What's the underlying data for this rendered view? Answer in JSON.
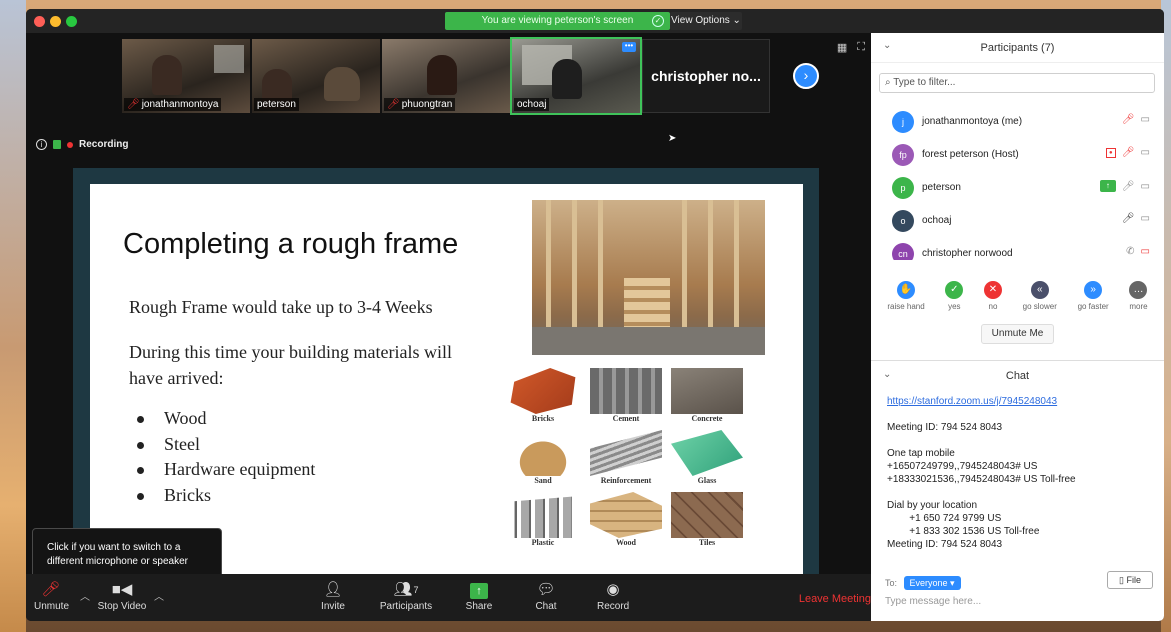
{
  "window": {
    "share_banner": "You are viewing peterson's screen",
    "view_options": "View Options ⌄"
  },
  "thumbnails": [
    {
      "label": "jonathanmontoya",
      "muted": true
    },
    {
      "label": "peterson",
      "muted": false
    },
    {
      "label": "phuongtran",
      "muted": true
    },
    {
      "label": "ochoaj",
      "muted": false,
      "active": true
    },
    {
      "label": "christopher no..."
    }
  ],
  "recording": {
    "label": "Recording"
  },
  "slide": {
    "title": "Completing a rough frame",
    "line1": "Rough Frame would take up to 3-4 Weeks",
    "line2": "During this time your building materials will have arrived:",
    "bullets": [
      "Wood",
      "Steel",
      "Hardware equipment",
      "Bricks"
    ],
    "materials": [
      "Bricks",
      "Cement",
      "Concrete",
      "Sand",
      "Reinforcement",
      "Glass",
      "Plastic",
      "Wood",
      "Tiles"
    ]
  },
  "tooltip": {
    "text": "Click if you want to switch to a different microphone or speaker"
  },
  "toolbar": {
    "unmute": "Unmute",
    "stop_video": "Stop Video",
    "invite": "Invite",
    "participants": "Participants",
    "participants_count": "7",
    "share": "Share",
    "chat": "Chat",
    "record": "Record",
    "leave": "Leave Meeting"
  },
  "participants_panel": {
    "title": "Participants (7)",
    "filter_placeholder": "Type to filter...",
    "list": [
      {
        "initials": "j",
        "name": "jonathanmontoya (me)",
        "color": "#2d8cff"
      },
      {
        "initials": "fp",
        "name": "forest peterson (Host)",
        "color": "#9b59b6"
      },
      {
        "initials": "p",
        "name": "peterson",
        "color": "#3cb54a"
      },
      {
        "initials": "o",
        "name": "ochoaj",
        "color": "#34495e"
      },
      {
        "initials": "cn",
        "name": "christopher norwood",
        "color": "#8e44ad"
      }
    ],
    "reactions": [
      {
        "label": "raise hand",
        "color": "#2d8cff",
        "glyph": "✋"
      },
      {
        "label": "yes",
        "color": "#3cb54a",
        "glyph": "✓"
      },
      {
        "label": "no",
        "color": "#e33",
        "glyph": "✕"
      },
      {
        "label": "go slower",
        "color": "#4a4f6a",
        "glyph": "«"
      },
      {
        "label": "go faster",
        "color": "#2d8cff",
        "glyph": "»"
      },
      {
        "label": "more",
        "color": "#666",
        "glyph": "…"
      }
    ],
    "unmute_me": "Unmute Me"
  },
  "chat": {
    "title": "Chat",
    "link": "https://stanford.zoom.us/j/7945248043",
    "meeting_id": "Meeting ID: 794 524 8043",
    "one_tap": "One tap mobile\n+16507249799,,7945248043# US\n+18333021536,,7945248043# US Toll-free",
    "dial": "Dial by your location\n        +1 650 724 9799 US\n        +1 833 302 1536 US Toll-free\nMeeting ID: 794 524 8043",
    "to_label": "To:",
    "to_value": "Everyone ▾",
    "file_label": "File",
    "input_placeholder": "Type message here..."
  }
}
